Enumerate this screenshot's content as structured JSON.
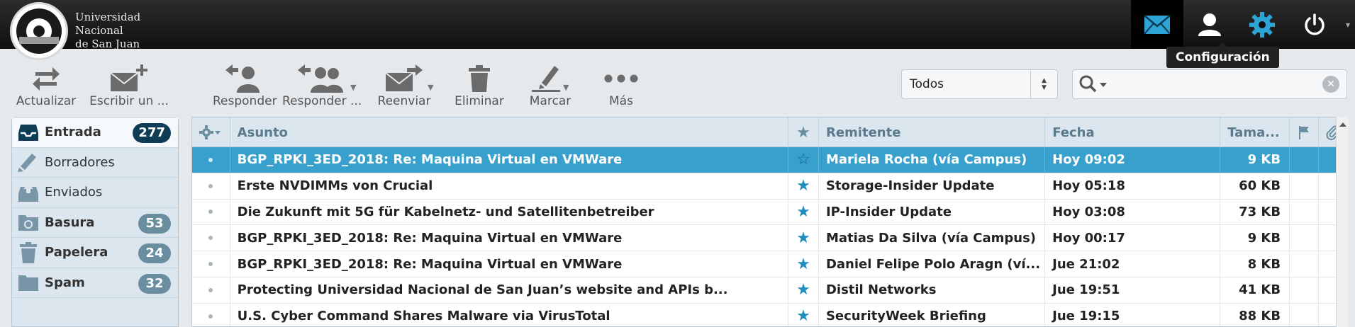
{
  "header": {
    "university_lines": [
      "Universidad",
      "Nacional",
      "de San Juan"
    ],
    "top_icons": [
      "mail-icon",
      "user-icon",
      "gear-icon",
      "power-icon"
    ],
    "tooltip": "Configuración",
    "accent_color": "#37a0cd"
  },
  "toolbar": {
    "refresh": "Actualizar",
    "compose": "Escribir un ...",
    "reply": "Responder",
    "reply_all": "Responder ...",
    "forward": "Reenviar",
    "delete": "Eliminar",
    "mark": "Marcar",
    "more": "Más"
  },
  "filter": {
    "selected": "Todos"
  },
  "search": {
    "placeholder": ""
  },
  "folders": [
    {
      "name": "Entrada",
      "count": "277",
      "icon": "inbox-icon"
    },
    {
      "name": "Borradores",
      "count": "",
      "icon": "pencil-icon"
    },
    {
      "name": "Enviados",
      "count": "",
      "icon": "sent-icon"
    },
    {
      "name": "Basura",
      "count": "53",
      "icon": "junk-icon"
    },
    {
      "name": "Papelera",
      "count": "24",
      "icon": "trash-icon"
    },
    {
      "name": "Spam",
      "count": "32",
      "icon": "folder-icon"
    }
  ],
  "columns": {
    "subject": "Asunto",
    "from": "Remitente",
    "date": "Fecha",
    "size": "Tama..."
  },
  "messages": [
    {
      "subject": "BGP_RPKI_3ED_2018: Re: Maquina Virtual en VMWare",
      "from": "Mariela Rocha (vía Campus)",
      "date": "Hoy 09:02",
      "size": "9 KB"
    },
    {
      "subject": "Erste NVDIMMs von Crucial",
      "from": "Storage-Insider Update",
      "date": "Hoy 05:18",
      "size": "60 KB"
    },
    {
      "subject": "Die Zukunft mit 5G für Kabelnetz- und Satellitenbetreiber",
      "from": "IP-Insider Update",
      "date": "Hoy 03:08",
      "size": "73 KB"
    },
    {
      "subject": "BGP_RPKI_3ED_2018: Re: Maquina Virtual en VMWare",
      "from": "Matias Da Silva (vía Campus)",
      "date": "Hoy 00:17",
      "size": "9 KB"
    },
    {
      "subject": "BGP_RPKI_3ED_2018: Re: Maquina Virtual en VMWare",
      "from": "Daniel Felipe Polo Aragn (ví...",
      "date": "Jue 21:02",
      "size": "8 KB"
    },
    {
      "subject": "Protecting Universidad Nacional de San Juan’s website and APIs b...",
      "from": "Distil Networks",
      "date": "Jue 19:51",
      "size": "41 KB"
    },
    {
      "subject": "U.S. Cyber Command Shares Malware via VirusTotal",
      "from": "SecurityWeek Briefing",
      "date": "Jue 19:15",
      "size": "88 KB"
    }
  ]
}
